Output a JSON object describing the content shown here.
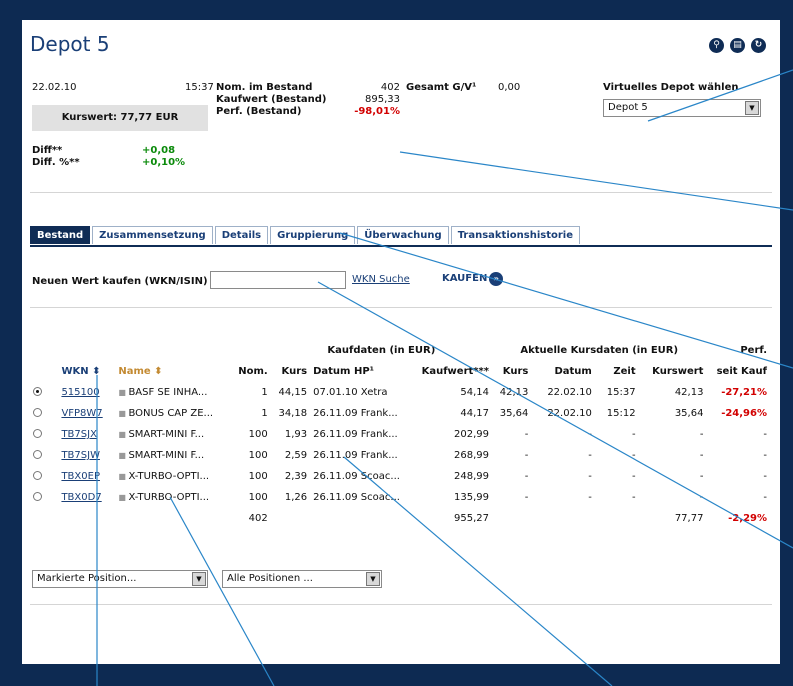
{
  "page": {
    "title": "Depot 5"
  },
  "icons": [
    "search-icon",
    "print-icon",
    "refresh-icon"
  ],
  "summary": {
    "date": "22.02.10",
    "time": "15:37",
    "kurswert_label": "Kurswert: 77,77 EUR",
    "nom_label": "Nom. im Bestand",
    "nom_value": "402",
    "kaufwert_label": "Kaufwert (Bestand)",
    "kaufwert_value": "895,33",
    "perf_label": "Perf. (Bestand)",
    "perf_value": "-98,01%",
    "gesamt_label": "Gesamt G/V¹",
    "gesamt_value": "0,00",
    "diff_label": "Diff**",
    "diff_value": "+0,08",
    "diffpct_label": "Diff. %**",
    "diffpct_value": "+0,10%"
  },
  "depot_select": {
    "label": "Virtuelles Depot wählen",
    "value": "Depot 5"
  },
  "tabs": [
    "Bestand",
    "Zusammensetzung",
    "Details",
    "Gruppierung",
    "Überwachung",
    "Transaktionshistorie"
  ],
  "buy": {
    "label": "Neuen Wert kaufen (WKN/ISIN)",
    "value": "",
    "search_link": "WKN Suche",
    "button": "KAUFEN"
  },
  "table": {
    "group_kauf": "Kaufdaten (in EUR)",
    "group_aktuell": "Aktuelle Kursdaten (in EUR)",
    "group_perf": "Perf.",
    "headers": {
      "wkn": "WKN ⬍",
      "name": "Name ⬍",
      "nom": "Nom.",
      "kurs": "Kurs",
      "datum_hp": "Datum HP¹",
      "kaufwert": "Kaufwert***",
      "akurs": "Kurs",
      "adatum": "Datum",
      "zeit": "Zeit",
      "kurswert": "Kurswert",
      "perf": "seit Kauf"
    },
    "rows": [
      {
        "wkn": "515100",
        "name": "BASF SE INHA...",
        "nom": "1",
        "kurs": "44,15",
        "datum_hp": "07.01.10 Xetra",
        "kaufwert": "54,14",
        "akurs": "42,13",
        "adatum": "22.02.10",
        "zeit": "15:37",
        "kurswert": "42,13",
        "perf": "-27,21%"
      },
      {
        "wkn": "VFP8W7",
        "name": "BONUS CAP ZE...",
        "nom": "1",
        "kurs": "34,18",
        "datum_hp": "26.11.09 Frank...",
        "kaufwert": "44,17",
        "akurs": "35,64",
        "adatum": "22.02.10",
        "zeit": "15:12",
        "kurswert": "35,64",
        "perf": "-24,96%"
      },
      {
        "wkn": "TB7SJX",
        "name": "SMART-MINI F...",
        "nom": "100",
        "kurs": "1,93",
        "datum_hp": "26.11.09 Frank...",
        "kaufwert": "202,99",
        "akurs": "-",
        "adatum": "-",
        "zeit": "-",
        "kurswert": "-",
        "perf": "-"
      },
      {
        "wkn": "TB7SJW",
        "name": "SMART-MINI F...",
        "nom": "100",
        "kurs": "2,59",
        "datum_hp": "26.11.09 Frank...",
        "kaufwert": "268,99",
        "akurs": "-",
        "adatum": "-",
        "zeit": "-",
        "kurswert": "-",
        "perf": "-"
      },
      {
        "wkn": "TBX0EP",
        "name": "X-TURBO-OPTI...",
        "nom": "100",
        "kurs": "2,39",
        "datum_hp": "26.11.09 Scoac...",
        "kaufwert": "248,99",
        "akurs": "-",
        "adatum": "-",
        "zeit": "-",
        "kurswert": "-",
        "perf": "-"
      },
      {
        "wkn": "TBX0D7",
        "name": "X-TURBO-OPTI...",
        "nom": "100",
        "kurs": "1,26",
        "datum_hp": "26.11.09 Scoac...",
        "kaufwert": "135,99",
        "akurs": "-",
        "adatum": "-",
        "zeit": "-",
        "kurswert": "-",
        "perf": "-"
      }
    ],
    "totals": {
      "nom": "402",
      "kaufwert": "955,27",
      "kurswert": "77,77",
      "perf": "-2,29%"
    }
  },
  "bottom": {
    "select1": "Markierte Position...",
    "select2": "Alle Positionen ..."
  },
  "colors": {
    "frame": "#0d2a52",
    "accent": "#1a3f77",
    "negative": "#d20000",
    "positive": "#0a8a0a"
  }
}
